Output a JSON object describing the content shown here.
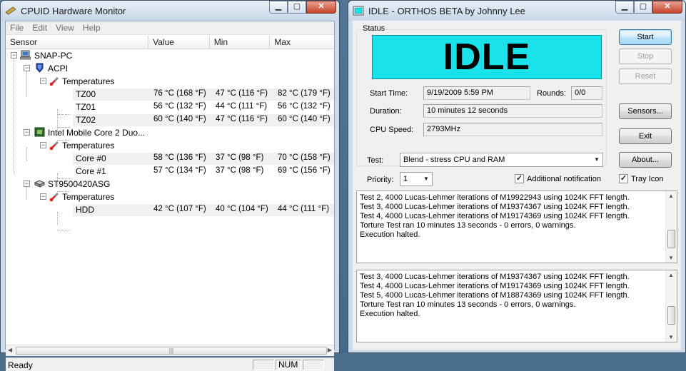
{
  "hwmon": {
    "title": "CPUID Hardware Monitor",
    "menu": [
      "File",
      "Edit",
      "View",
      "Help"
    ],
    "columns": [
      "Sensor",
      "Value",
      "Min",
      "Max"
    ],
    "tree": [
      {
        "kind": "root",
        "label": "SNAP-PC"
      },
      {
        "kind": "device",
        "label": "ACPI"
      },
      {
        "kind": "category",
        "label": "Temperatures"
      },
      {
        "kind": "sensor",
        "label": "TZ00",
        "value": "76 °C (168 °F)",
        "min": "47 °C (116 °F)",
        "max": "82 °C (179 °F)"
      },
      {
        "kind": "sensor",
        "label": "TZ01",
        "value": "56 °C (132 °F)",
        "min": "44 °C (111 °F)",
        "max": "56 °C (132 °F)"
      },
      {
        "kind": "sensor",
        "label": "TZ02",
        "value": "60 °C (140 °F)",
        "min": "47 °C (116 °F)",
        "max": "60 °C (140 °F)"
      },
      {
        "kind": "device",
        "label": "Intel Mobile Core 2 Duo..."
      },
      {
        "kind": "category",
        "label": "Temperatures"
      },
      {
        "kind": "sensor",
        "label": "Core #0",
        "value": "58 °C (136 °F)",
        "min": "37 °C (98 °F)",
        "max": "70 °C (158 °F)"
      },
      {
        "kind": "sensor",
        "label": "Core #1",
        "value": "57 °C (134 °F)",
        "min": "37 °C (98 °F)",
        "max": "69 °C (156 °F)"
      },
      {
        "kind": "device",
        "label": "ST9500420ASG"
      },
      {
        "kind": "category",
        "label": "Temperatures"
      },
      {
        "kind": "sensor",
        "label": "HDD",
        "value": "42 °C (107 °F)",
        "min": "40 °C (104 °F)",
        "max": "44 °C (111 °F)"
      }
    ],
    "status": {
      "text": "Ready",
      "num": "NUM"
    }
  },
  "orthos": {
    "title": "IDLE - ORTHOS BETA by Johnny Lee",
    "status_group": "Status",
    "state": "IDLE",
    "state_color": "#19e2eb",
    "start_time_label": "Start Time:",
    "start_time": "9/19/2009 5:59 PM",
    "rounds_label": "Rounds:",
    "rounds": "0/0",
    "duration_label": "Duration:",
    "duration": "10 minutes 12 seconds",
    "cpu_speed_label": "CPU Speed:",
    "cpu_speed": "2793MHz",
    "buttons": {
      "start": "Start",
      "stop": "Stop",
      "reset": "Reset",
      "sensors": "Sensors...",
      "exit": "Exit",
      "about": "About..."
    },
    "test_label": "Test:",
    "test_value": "Blend - stress CPU and RAM",
    "priority_label": "Priority:",
    "priority_value": "1",
    "additional_notification": "Additional notification",
    "tray_icon": "Tray Icon",
    "log1": [
      "Test 2, 4000 Lucas-Lehmer iterations of M19922943 using 1024K FFT length.",
      "Test 3, 4000 Lucas-Lehmer iterations of M19374367 using 1024K FFT length.",
      "Test 4, 4000 Lucas-Lehmer iterations of M19174369 using 1024K FFT length.",
      "Torture Test ran 10 minutes 13 seconds - 0 errors, 0 warnings.",
      "Execution halted."
    ],
    "log2": [
      "Test 3, 4000 Lucas-Lehmer iterations of M19374367 using 1024K FFT length.",
      "Test 4, 4000 Lucas-Lehmer iterations of M19174369 using 1024K FFT length.",
      "Test 5, 4000 Lucas-Lehmer iterations of M18874369 using 1024K FFT length.",
      "Torture Test ran 10 minutes 13 seconds - 0 errors, 0 warnings.",
      "Execution halted."
    ]
  }
}
